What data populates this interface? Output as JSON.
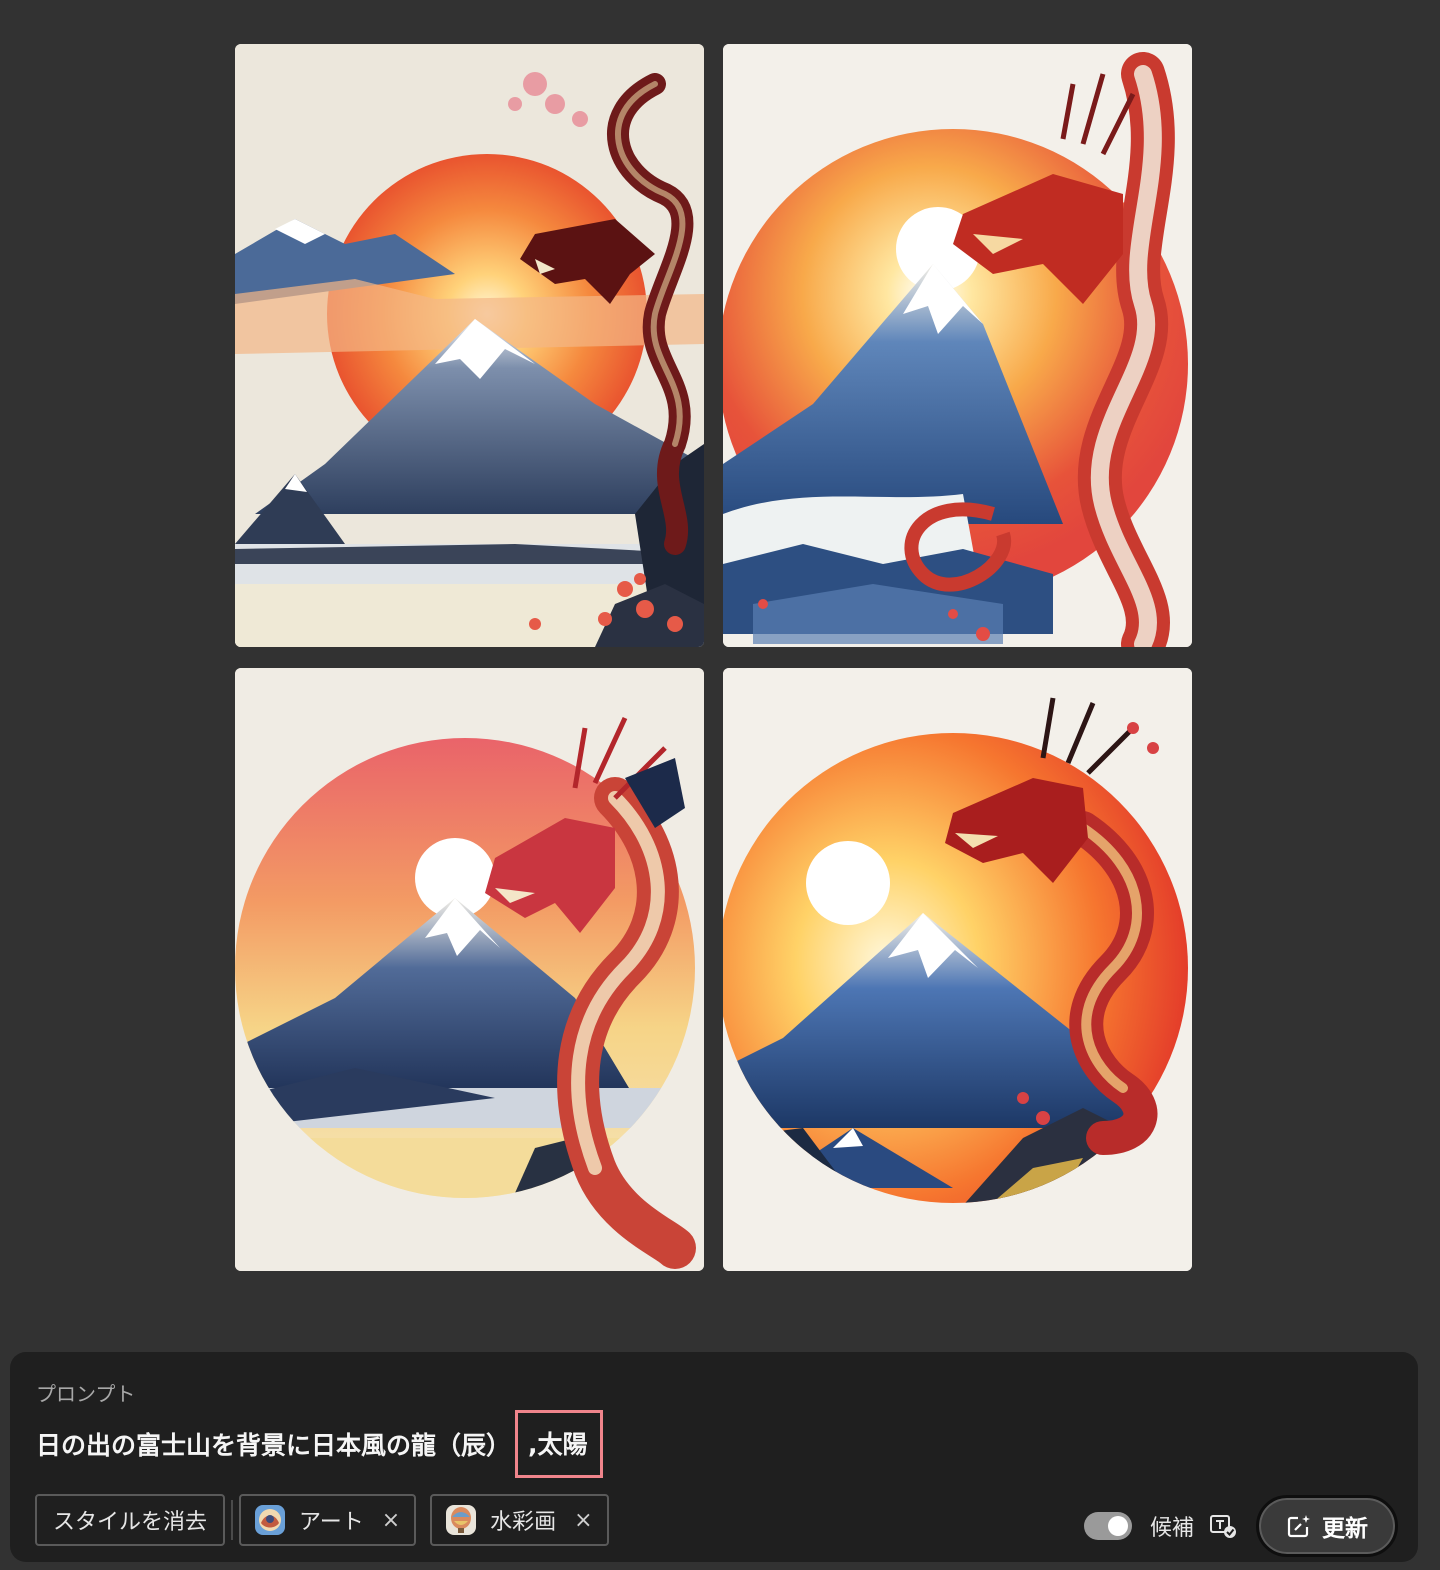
{
  "images": [
    {
      "label": "generated-image-1"
    },
    {
      "label": "generated-image-2"
    },
    {
      "label": "generated-image-3"
    },
    {
      "label": "generated-image-4"
    }
  ],
  "prompt": {
    "label": "プロンプト",
    "text_main": "日の出の富士山を背景に日本風の龍（辰）",
    "text_highlight": ",太陽"
  },
  "styles": {
    "clear_label": "スタイルを消去",
    "chips": [
      {
        "label": "アート",
        "close": "×"
      },
      {
        "label": "水彩画",
        "close": "×"
      }
    ]
  },
  "controls": {
    "suggest_label": "候補",
    "suggest_enabled": true,
    "update_label": "更新"
  },
  "colors": {
    "background": "#323232",
    "panel": "#1f1f1f",
    "highlight_border": "#f0858c"
  }
}
